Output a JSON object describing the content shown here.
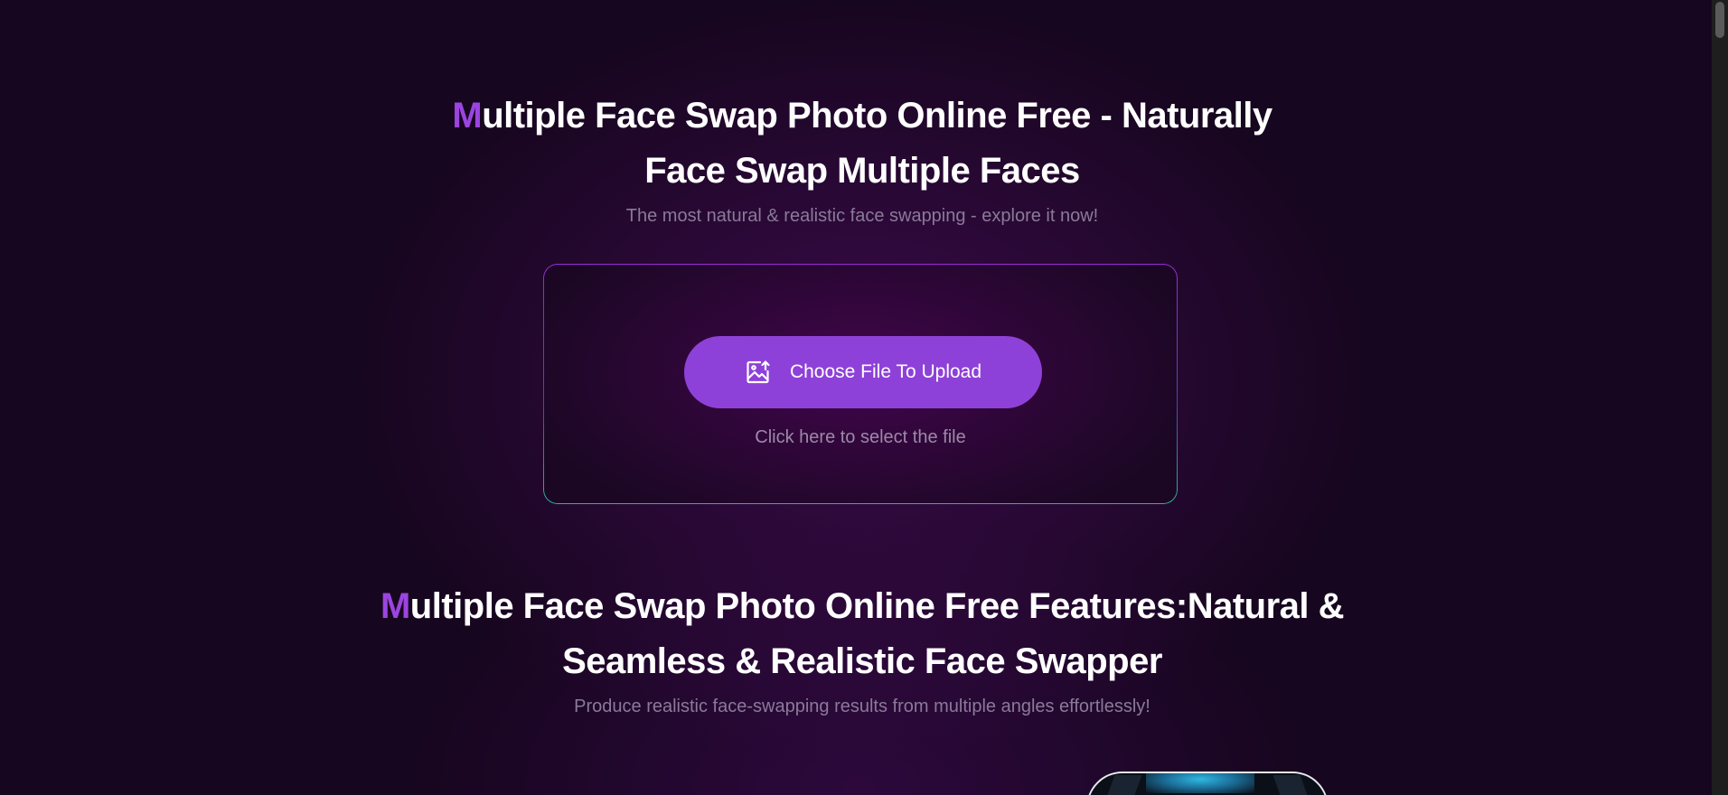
{
  "hero": {
    "title_accent": "M",
    "title_line1_rest": "ultiple Face Swap Photo Online Free - Naturally",
    "title_line2": "Face Swap Multiple Faces",
    "subtitle": "The most natural & realistic face swapping - explore it now!"
  },
  "upload": {
    "button_label": "Choose File To Upload",
    "button_icon": "image-upload-icon",
    "hint": "Click here to select the file"
  },
  "features": {
    "title_accent": "M",
    "title_line1_rest": "ultiple Face Swap Photo Online Free Features:Natural &",
    "title_line2": "Seamless & Realistic Face Swapper",
    "subtitle": "Produce realistic face-swapping results from multiple angles effortlessly!"
  },
  "colors": {
    "background": "#17061f",
    "accent": "#9b45e0",
    "button": "#8e41d8",
    "muted_text": "#8a7a98"
  }
}
